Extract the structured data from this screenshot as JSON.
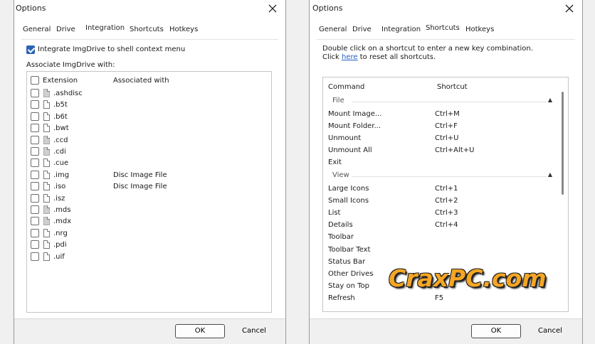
{
  "left": {
    "title": "Options",
    "tabs": [
      "General",
      "Drive",
      "Integration",
      "Shortcuts",
      "Hotkeys"
    ],
    "active_tab": "Integration",
    "integrate_label": "Integrate ImgDrive to shell context menu",
    "integrate_checked": true,
    "associate_label": "Associate ImgDrive with:",
    "columns": [
      "Extension",
      "Associated with"
    ],
    "rows": [
      {
        "ext": ".ashdisc",
        "assoc": ""
      },
      {
        "ext": ".b5t",
        "assoc": ""
      },
      {
        "ext": ".b6t",
        "assoc": ""
      },
      {
        "ext": ".bwt",
        "assoc": ""
      },
      {
        "ext": ".ccd",
        "assoc": ""
      },
      {
        "ext": ".cdi",
        "assoc": ""
      },
      {
        "ext": ".cue",
        "assoc": ""
      },
      {
        "ext": ".img",
        "assoc": "Disc Image File"
      },
      {
        "ext": ".iso",
        "assoc": "Disc Image File"
      },
      {
        "ext": ".isz",
        "assoc": ""
      },
      {
        "ext": ".mds",
        "assoc": ""
      },
      {
        "ext": ".mdx",
        "assoc": ""
      },
      {
        "ext": ".nrg",
        "assoc": ""
      },
      {
        "ext": ".pdi",
        "assoc": ""
      },
      {
        "ext": ".uif",
        "assoc": ""
      }
    ],
    "ok_label": "OK",
    "cancel_label": "Cancel"
  },
  "right": {
    "title": "Options",
    "tabs": [
      "General",
      "Drive",
      "Integration",
      "Shortcuts",
      "Hotkeys"
    ],
    "active_tab": "Shortcuts",
    "instruction": "Double click on a shortcut to enter a new key combination.",
    "reset_prefix": "Click ",
    "reset_link": "here",
    "reset_suffix": " to reset all shortcuts.",
    "columns": [
      "Command",
      "Shortcut"
    ],
    "groups": [
      {
        "name": "File",
        "items": [
          {
            "command": "Mount Image...",
            "shortcut": "Ctrl+M"
          },
          {
            "command": "Mount Folder...",
            "shortcut": "Ctrl+F"
          },
          {
            "command": "Unmount",
            "shortcut": "Ctrl+U"
          },
          {
            "command": "Unmount All",
            "shortcut": "Ctrl+Alt+U"
          },
          {
            "command": "Exit",
            "shortcut": ""
          }
        ]
      },
      {
        "name": "View",
        "items": [
          {
            "command": "Large Icons",
            "shortcut": "Ctrl+1"
          },
          {
            "command": "Small Icons",
            "shortcut": "Ctrl+2"
          },
          {
            "command": "List",
            "shortcut": "Ctrl+3"
          },
          {
            "command": "Details",
            "shortcut": "Ctrl+4"
          },
          {
            "command": "Toolbar",
            "shortcut": ""
          },
          {
            "command": "Toolbar Text",
            "shortcut": ""
          },
          {
            "command": "Status Bar",
            "shortcut": ""
          },
          {
            "command": "Other Drives",
            "shortcut": ""
          },
          {
            "command": "Stay on Top",
            "shortcut": ""
          },
          {
            "command": "Refresh",
            "shortcut": "F5"
          }
        ]
      }
    ],
    "ok_label": "OK",
    "cancel_label": "Cancel"
  },
  "watermark": "CraxPC.com",
  "colors": {
    "accent": "#2b63b6",
    "link": "#1f5fc4",
    "watermark": "#f5a623"
  }
}
